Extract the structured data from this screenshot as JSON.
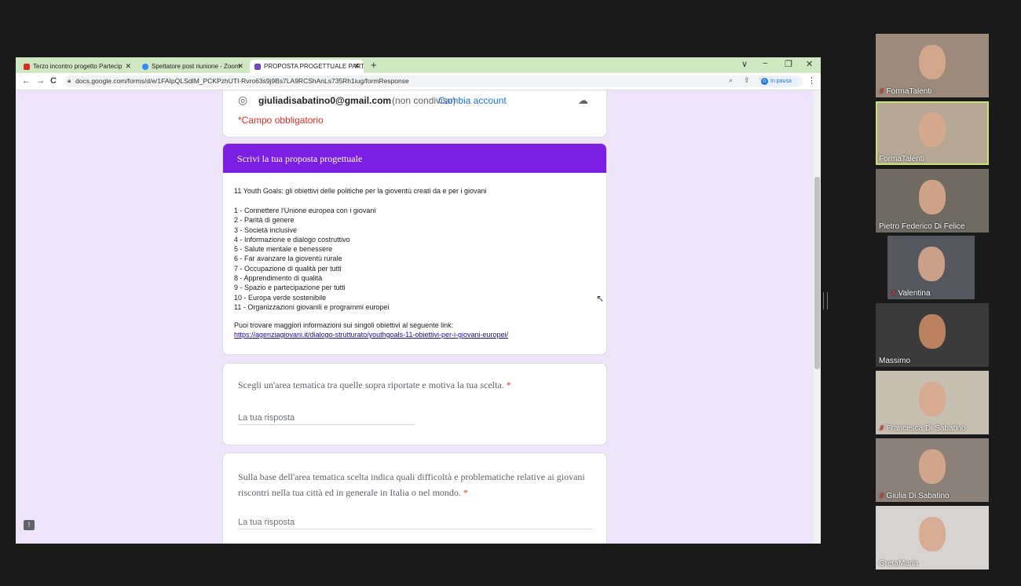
{
  "browser": {
    "tabs": [
      {
        "label": "Terzo incontro progetto Partecip",
        "icon": "gmail-icon",
        "color": "#d93025"
      },
      {
        "label": "Spettatore post riunione - Zoom",
        "icon": "zoom-icon",
        "color": "#2d8cff"
      },
      {
        "label": "PROPOSTA PROGETTUALE PARTE",
        "icon": "forms-icon",
        "color": "#7248b9"
      }
    ],
    "new_tab": "+",
    "window_controls": {
      "chevron": "∨",
      "minimize": "−",
      "restore": "❐",
      "close": "✕"
    },
    "url": "docs.google.com/forms/d/e/1FAIpQLSdIM_PCKPzhUTI-Rvro63s9j9Bs7LA9RCShAnLs735Rh1iug/formResponse",
    "profile_status": "In pausa",
    "profile_initial": "G"
  },
  "form": {
    "email": "giuliadisabatino0@gmail.com",
    "not_shared": "(non condiviso)",
    "change_account": "Cambia account",
    "required_note": "*Campo obbligatorio",
    "section_title": "Scrivi la tua proposta progettuale",
    "intro": "11 Youth Goals: gli obiettivi delle politiche per la gioventù creati da e per i giovani",
    "goals": [
      "1 - Connettere l'Unione europea con i giovani",
      "2 - Parità di genere",
      "3 - Società inclusive",
      "4 - Informazione e dialogo costruttivo",
      "5 - Salute mentale e benessere",
      "6 - Far avanzare la gioventù rurale",
      "7 - Occupazione di qualità per tutti",
      "8 - Apprendimento di qualità",
      "9 - Spazio e partecipazione per tutti",
      "10 - Europa verde sostenibile",
      "11 - Organizzazioni giovanili e programmi europei"
    ],
    "info_text": "Puoi trovare maggiori informazioni sui singoli obiettivi al seguente link:",
    "info_link": "https://agenziagiovani.it/dialogo-strutturato/youthgoals-11-obiettivi-per-i-giovani-europei/",
    "q1": "Scegli un'area tematica tra quelle sopra riportate e motiva la tua scelta.",
    "q2_line1": "Sulla base dell'area tematica scelta indica quali difficoltà e problematiche relative ai giovani",
    "q2_line2": "riscontri nella tua città ed in generale in Italia o nel mondo.",
    "required_mark": "*",
    "answer_placeholder": "La tua risposta",
    "accent": "#7b1fe4"
  },
  "participants": [
    {
      "name": "FormaTalenti",
      "muted": true
    },
    {
      "name": "FormaTalenti",
      "muted": false,
      "speaking": true
    },
    {
      "name": "Pietro Federico Di Felice",
      "muted": false
    },
    {
      "name": "Valentina",
      "muted": true
    },
    {
      "name": "Massimo",
      "muted": false
    },
    {
      "name": "Francesca Di Sabatino",
      "muted": true
    },
    {
      "name": "Giulia Di Sabatino",
      "muted": true
    },
    {
      "name": "GretaMaria",
      "muted": false
    }
  ]
}
